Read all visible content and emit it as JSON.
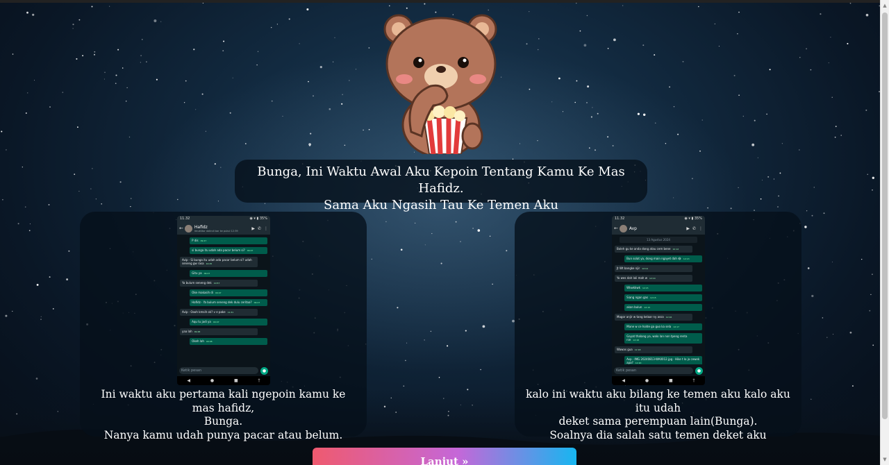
{
  "headline": {
    "line1": "Bunga, Ini Waktu Awal Aku Kepoin Tentang Kamu Ke Mas Hafidz.",
    "line2": "Sama Aku Ngasih Tau Ke Temen Aku"
  },
  "cards": [
    {
      "caption": {
        "line1": "Ini waktu aku pertama kali ngepoin kamu ke mas hafidz,",
        "line2": "Bunga.",
        "line3": "Nanya kamu udah punya pacar atau belum."
      },
      "screenshot": {
        "time": "11.32",
        "battery": "◉ ▾ ▮ 35%",
        "contact_name": "Hafidz",
        "contact_subtitle": "Imuktitor dalindi bar ke pukul 12:39",
        "composer_placeholder": "Ketik pesan",
        "messages": [
          {
            "dir": "out",
            "text": "P dis",
            "time": "09:47"
          },
          {
            "dir": "out",
            "text": "si bunga itu udah ada pacar belum si?",
            "time": "09:47"
          },
          {
            "dir": "in",
            "text": "Avip · Si bunga itu udah ada pacar belum si? udah seneng gw rasa",
            "time": "10:45"
          },
          {
            "dir": "out",
            "text": "Gitu ya",
            "time": "09:47"
          },
          {
            "dir": "in",
            "text": "Ya bulum seneng dek",
            "time": "10:57"
          },
          {
            "dir": "out",
            "text": "Oke makasih di",
            "time": "09:47"
          },
          {
            "dir": "out",
            "text": "Hafidz · Ya bulum seneng dek dulu ceritaa?",
            "time": "09:47"
          },
          {
            "dir": "in",
            "text": "Avip · Oooh kmsih ok? v  e pake",
            "time": "11:31"
          },
          {
            "dir": "out",
            "text": "Aqu tu jadi ya",
            "time": "09:47"
          },
          {
            "dir": "in",
            "text": "yaa lah",
            "time": "09:48"
          },
          {
            "dir": "out",
            "text": "Okeh lah",
            "time": "09:48"
          }
        ]
      }
    },
    {
      "caption": {
        "line1": "kalo ini waktu aku bilang ke temen aku kalo aku itu udah",
        "line2": "deket sama perempuan lain(Bunga).",
        "line3": "Soalnya dia salah satu temen deket aku"
      },
      "screenshot": {
        "time": "11.32",
        "battery": "◉ ▾ ▮ 35%",
        "contact_name": "Avp",
        "contact_subtitle": "",
        "composer_placeholder": "Ketik pesan",
        "messages": [
          {
            "dir": "date",
            "text": "13 Agustus 2024",
            "time": ""
          },
          {
            "dir": "in",
            "text": "Boleh gu ke anda dong atau cem bene",
            "time": "12:12"
          },
          {
            "dir": "out",
            "text": "Bun solat ya, dong main ngayet dah 😂",
            "time": "12:13"
          },
          {
            "dir": "in",
            "text": "Jt Wt bangke njir",
            "time": "12:14"
          },
          {
            "dir": "in",
            "text": "Yo wes dah lali mah w",
            "time": "12:14"
          },
          {
            "dir": "out",
            "text": "Wkwkkwk",
            "time": "12:15"
          },
          {
            "dir": "out",
            "text": "Siang ngan gas",
            "time": "12:15"
          },
          {
            "dir": "out",
            "text": "akan bulun",
            "time": "12:15"
          },
          {
            "dir": "in",
            "text": "Magor anjir w tang kelaar ny assa",
            "time": "12:16"
          },
          {
            "dir": "out",
            "text": "Mane w ce holde ga guo ka sela",
            "time": "12:17"
          },
          {
            "dir": "out",
            "text": "Gayat thalang ya, walo lan non tpeng renta nie",
            "time": "12:18"
          },
          {
            "dir": "in",
            "text": "Wawas gua",
            "time": "12:18"
          },
          {
            "dir": "out",
            "text": "Avp · IMG 20240813-WA0012.jpg · Hike t lo ja cewek apa?",
            "time": "12:20"
          }
        ]
      }
    }
  ],
  "next_button": {
    "label": "Lanjut »"
  },
  "colors": {
    "button_gradient_start": "#ef5a6f",
    "button_gradient_mid": "#c567d8",
    "button_gradient_end": "#17b6f0",
    "card_background": "rgba(5,15,25,0.78)",
    "whatsapp_outgoing": "#005c4b",
    "whatsapp_incoming": "#202c33"
  },
  "icons": {
    "bear": "bear-eating-popcorn-icon",
    "send": "mic-icon"
  }
}
